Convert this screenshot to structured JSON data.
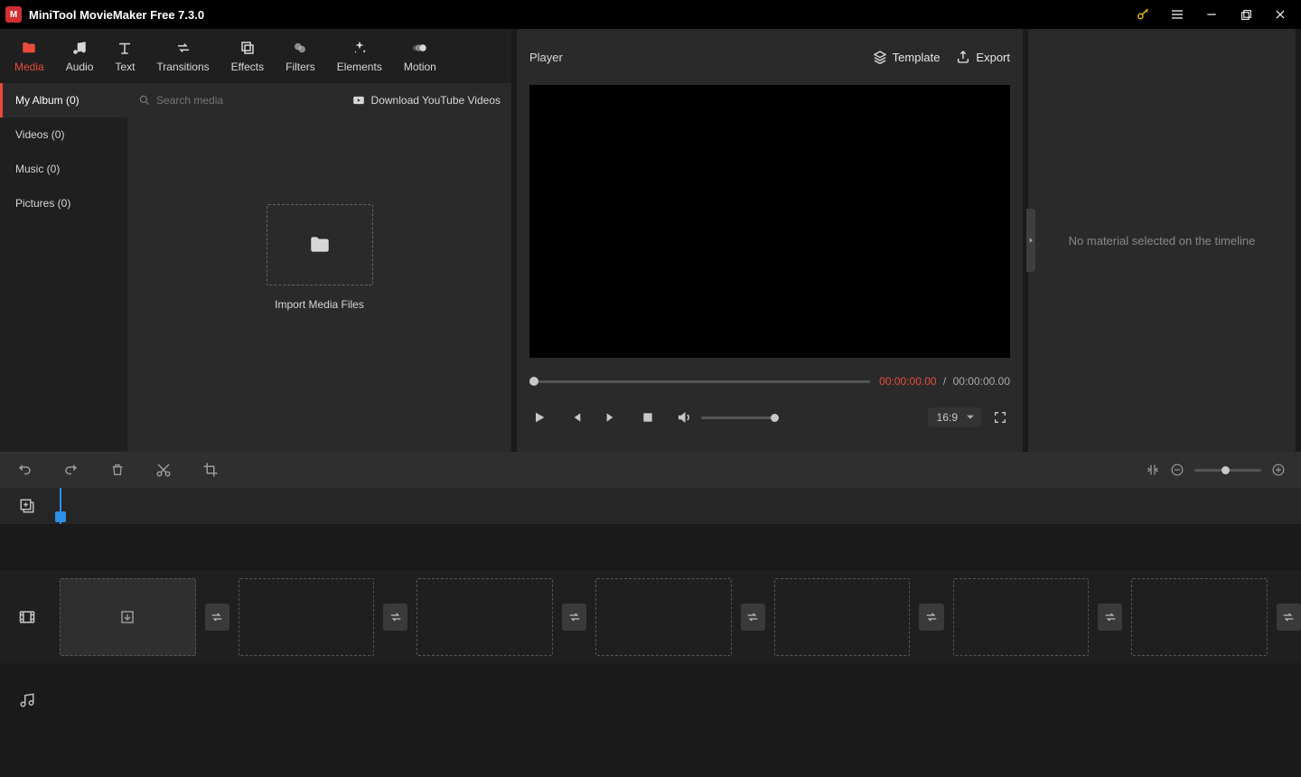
{
  "titlebar": {
    "app_title": "MiniTool MovieMaker Free 7.3.0"
  },
  "media_tabs": [
    {
      "label": "Media",
      "icon": "folder-icon",
      "active": true
    },
    {
      "label": "Audio",
      "icon": "music-note-icon",
      "active": false
    },
    {
      "label": "Text",
      "icon": "text-icon",
      "active": false
    },
    {
      "label": "Transitions",
      "icon": "swap-icon",
      "active": false
    },
    {
      "label": "Effects",
      "icon": "stack-icon",
      "active": false
    },
    {
      "label": "Filters",
      "icon": "circles-icon",
      "active": false
    },
    {
      "label": "Elements",
      "icon": "sparkle-icon",
      "active": false
    },
    {
      "label": "Motion",
      "icon": "motion-icon",
      "active": false
    }
  ],
  "sidebar": {
    "items": [
      {
        "label": "My Album (0)",
        "active": true
      },
      {
        "label": "Videos (0)",
        "active": false
      },
      {
        "label": "Music (0)",
        "active": false
      },
      {
        "label": "Pictures (0)",
        "active": false
      }
    ]
  },
  "search": {
    "placeholder": "Search media"
  },
  "download_link": "Download YouTube Videos",
  "import_label": "Import Media Files",
  "player": {
    "title": "Player",
    "template_label": "Template",
    "export_label": "Export",
    "current_time": "00:00:00.00",
    "separator": "/",
    "total_time": "00:00:00.00",
    "aspect": "16:9"
  },
  "inspector": {
    "empty_msg": "No material selected on the timeline"
  }
}
